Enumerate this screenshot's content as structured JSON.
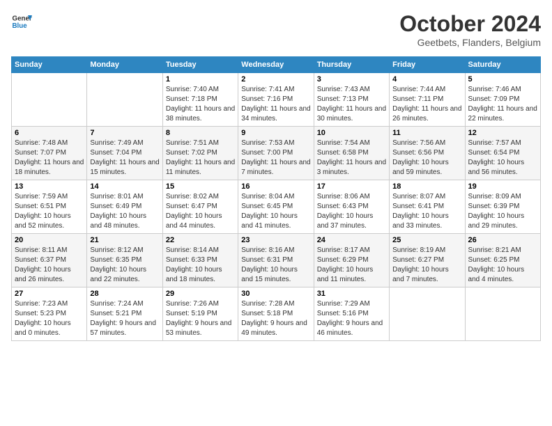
{
  "header": {
    "logo_general": "General",
    "logo_blue": "Blue",
    "month_title": "October 2024",
    "location": "Geetbets, Flanders, Belgium"
  },
  "days_of_week": [
    "Sunday",
    "Monday",
    "Tuesday",
    "Wednesday",
    "Thursday",
    "Friday",
    "Saturday"
  ],
  "weeks": [
    [
      {
        "day": "",
        "sunrise": "",
        "sunset": "",
        "daylight": ""
      },
      {
        "day": "",
        "sunrise": "",
        "sunset": "",
        "daylight": ""
      },
      {
        "day": "1",
        "sunrise": "Sunrise: 7:40 AM",
        "sunset": "Sunset: 7:18 PM",
        "daylight": "Daylight: 11 hours and 38 minutes."
      },
      {
        "day": "2",
        "sunrise": "Sunrise: 7:41 AM",
        "sunset": "Sunset: 7:16 PM",
        "daylight": "Daylight: 11 hours and 34 minutes."
      },
      {
        "day": "3",
        "sunrise": "Sunrise: 7:43 AM",
        "sunset": "Sunset: 7:13 PM",
        "daylight": "Daylight: 11 hours and 30 minutes."
      },
      {
        "day": "4",
        "sunrise": "Sunrise: 7:44 AM",
        "sunset": "Sunset: 7:11 PM",
        "daylight": "Daylight: 11 hours and 26 minutes."
      },
      {
        "day": "5",
        "sunrise": "Sunrise: 7:46 AM",
        "sunset": "Sunset: 7:09 PM",
        "daylight": "Daylight: 11 hours and 22 minutes."
      }
    ],
    [
      {
        "day": "6",
        "sunrise": "Sunrise: 7:48 AM",
        "sunset": "Sunset: 7:07 PM",
        "daylight": "Daylight: 11 hours and 18 minutes."
      },
      {
        "day": "7",
        "sunrise": "Sunrise: 7:49 AM",
        "sunset": "Sunset: 7:04 PM",
        "daylight": "Daylight: 11 hours and 15 minutes."
      },
      {
        "day": "8",
        "sunrise": "Sunrise: 7:51 AM",
        "sunset": "Sunset: 7:02 PM",
        "daylight": "Daylight: 11 hours and 11 minutes."
      },
      {
        "day": "9",
        "sunrise": "Sunrise: 7:53 AM",
        "sunset": "Sunset: 7:00 PM",
        "daylight": "Daylight: 11 hours and 7 minutes."
      },
      {
        "day": "10",
        "sunrise": "Sunrise: 7:54 AM",
        "sunset": "Sunset: 6:58 PM",
        "daylight": "Daylight: 11 hours and 3 minutes."
      },
      {
        "day": "11",
        "sunrise": "Sunrise: 7:56 AM",
        "sunset": "Sunset: 6:56 PM",
        "daylight": "Daylight: 10 hours and 59 minutes."
      },
      {
        "day": "12",
        "sunrise": "Sunrise: 7:57 AM",
        "sunset": "Sunset: 6:54 PM",
        "daylight": "Daylight: 10 hours and 56 minutes."
      }
    ],
    [
      {
        "day": "13",
        "sunrise": "Sunrise: 7:59 AM",
        "sunset": "Sunset: 6:51 PM",
        "daylight": "Daylight: 10 hours and 52 minutes."
      },
      {
        "day": "14",
        "sunrise": "Sunrise: 8:01 AM",
        "sunset": "Sunset: 6:49 PM",
        "daylight": "Daylight: 10 hours and 48 minutes."
      },
      {
        "day": "15",
        "sunrise": "Sunrise: 8:02 AM",
        "sunset": "Sunset: 6:47 PM",
        "daylight": "Daylight: 10 hours and 44 minutes."
      },
      {
        "day": "16",
        "sunrise": "Sunrise: 8:04 AM",
        "sunset": "Sunset: 6:45 PM",
        "daylight": "Daylight: 10 hours and 41 minutes."
      },
      {
        "day": "17",
        "sunrise": "Sunrise: 8:06 AM",
        "sunset": "Sunset: 6:43 PM",
        "daylight": "Daylight: 10 hours and 37 minutes."
      },
      {
        "day": "18",
        "sunrise": "Sunrise: 8:07 AM",
        "sunset": "Sunset: 6:41 PM",
        "daylight": "Daylight: 10 hours and 33 minutes."
      },
      {
        "day": "19",
        "sunrise": "Sunrise: 8:09 AM",
        "sunset": "Sunset: 6:39 PM",
        "daylight": "Daylight: 10 hours and 29 minutes."
      }
    ],
    [
      {
        "day": "20",
        "sunrise": "Sunrise: 8:11 AM",
        "sunset": "Sunset: 6:37 PM",
        "daylight": "Daylight: 10 hours and 26 minutes."
      },
      {
        "day": "21",
        "sunrise": "Sunrise: 8:12 AM",
        "sunset": "Sunset: 6:35 PM",
        "daylight": "Daylight: 10 hours and 22 minutes."
      },
      {
        "day": "22",
        "sunrise": "Sunrise: 8:14 AM",
        "sunset": "Sunset: 6:33 PM",
        "daylight": "Daylight: 10 hours and 18 minutes."
      },
      {
        "day": "23",
        "sunrise": "Sunrise: 8:16 AM",
        "sunset": "Sunset: 6:31 PM",
        "daylight": "Daylight: 10 hours and 15 minutes."
      },
      {
        "day": "24",
        "sunrise": "Sunrise: 8:17 AM",
        "sunset": "Sunset: 6:29 PM",
        "daylight": "Daylight: 10 hours and 11 minutes."
      },
      {
        "day": "25",
        "sunrise": "Sunrise: 8:19 AM",
        "sunset": "Sunset: 6:27 PM",
        "daylight": "Daylight: 10 hours and 7 minutes."
      },
      {
        "day": "26",
        "sunrise": "Sunrise: 8:21 AM",
        "sunset": "Sunset: 6:25 PM",
        "daylight": "Daylight: 10 hours and 4 minutes."
      }
    ],
    [
      {
        "day": "27",
        "sunrise": "Sunrise: 7:23 AM",
        "sunset": "Sunset: 5:23 PM",
        "daylight": "Daylight: 10 hours and 0 minutes."
      },
      {
        "day": "28",
        "sunrise": "Sunrise: 7:24 AM",
        "sunset": "Sunset: 5:21 PM",
        "daylight": "Daylight: 9 hours and 57 minutes."
      },
      {
        "day": "29",
        "sunrise": "Sunrise: 7:26 AM",
        "sunset": "Sunset: 5:19 PM",
        "daylight": "Daylight: 9 hours and 53 minutes."
      },
      {
        "day": "30",
        "sunrise": "Sunrise: 7:28 AM",
        "sunset": "Sunset: 5:18 PM",
        "daylight": "Daylight: 9 hours and 49 minutes."
      },
      {
        "day": "31",
        "sunrise": "Sunrise: 7:29 AM",
        "sunset": "Sunset: 5:16 PM",
        "daylight": "Daylight: 9 hours and 46 minutes."
      },
      {
        "day": "",
        "sunrise": "",
        "sunset": "",
        "daylight": ""
      },
      {
        "day": "",
        "sunrise": "",
        "sunset": "",
        "daylight": ""
      }
    ]
  ]
}
